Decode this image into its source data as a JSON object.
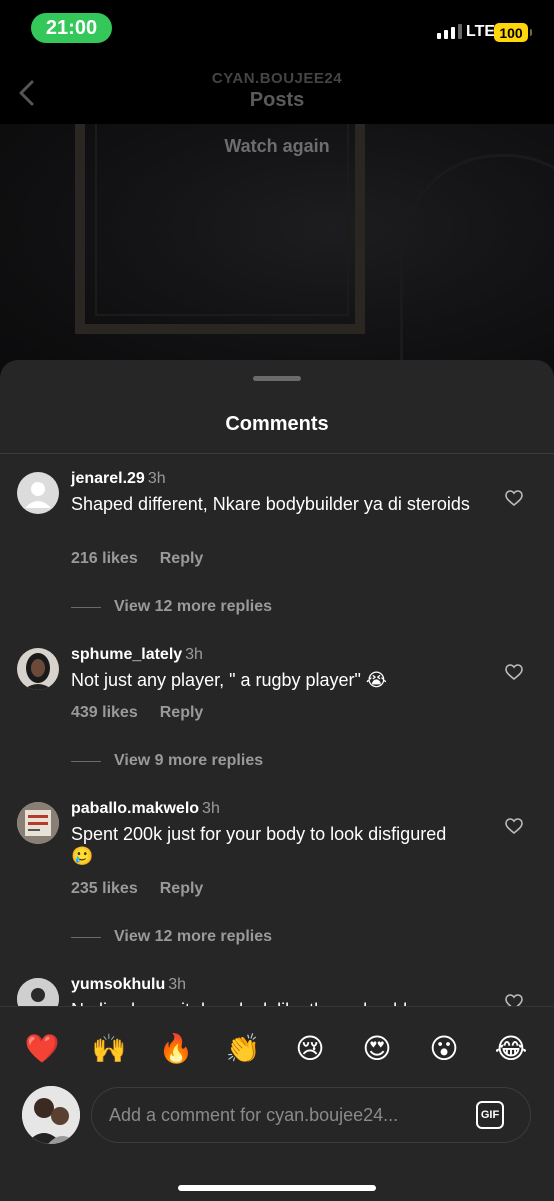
{
  "status_bar": {
    "time": "21:00",
    "network": "LTE",
    "battery": "100"
  },
  "header": {
    "account": "CYAN.BOUJEE24",
    "title": "Posts"
  },
  "video": {
    "watch_again": "Watch again"
  },
  "comments_sheet": {
    "title": "Comments",
    "comments": [
      {
        "user": "jenarel.29",
        "time": "3h",
        "text": "Shaped different, Nkare bodybuilder ya di steroids",
        "likes": "216 likes",
        "reply": "Reply",
        "view_replies": "View 12 more replies"
      },
      {
        "user": "sphume_lately",
        "time": "3h",
        "text": "Not just any player, \" a rugby player\" 😭",
        "likes": "439 likes",
        "reply": "Reply",
        "view_replies": "View 9 more replies"
      },
      {
        "user": "paballo.makwelo",
        "time": "3h",
        "text": "Spent 200k just for your body to look disfigured 🥲",
        "likes": "235 likes",
        "reply": "Reply",
        "view_replies": "View 12 more replies"
      },
      {
        "user": "yumsokhulu",
        "time": "3h",
        "text": "No lie shame it does look like them shoulders"
      }
    ]
  },
  "emoji_bar": [
    "❤️",
    "🙌",
    "🔥",
    "👏",
    "😢",
    "😍",
    "😮",
    "😂"
  ],
  "composer": {
    "placeholder": "Add a comment for cyan.boujee24...",
    "gif_label": "GIF"
  },
  "colors": {
    "sheet_bg": "#262626",
    "muted_text": "#9a9a9a",
    "status_green": "#34c759",
    "battery_yellow": "#ffd60a"
  }
}
